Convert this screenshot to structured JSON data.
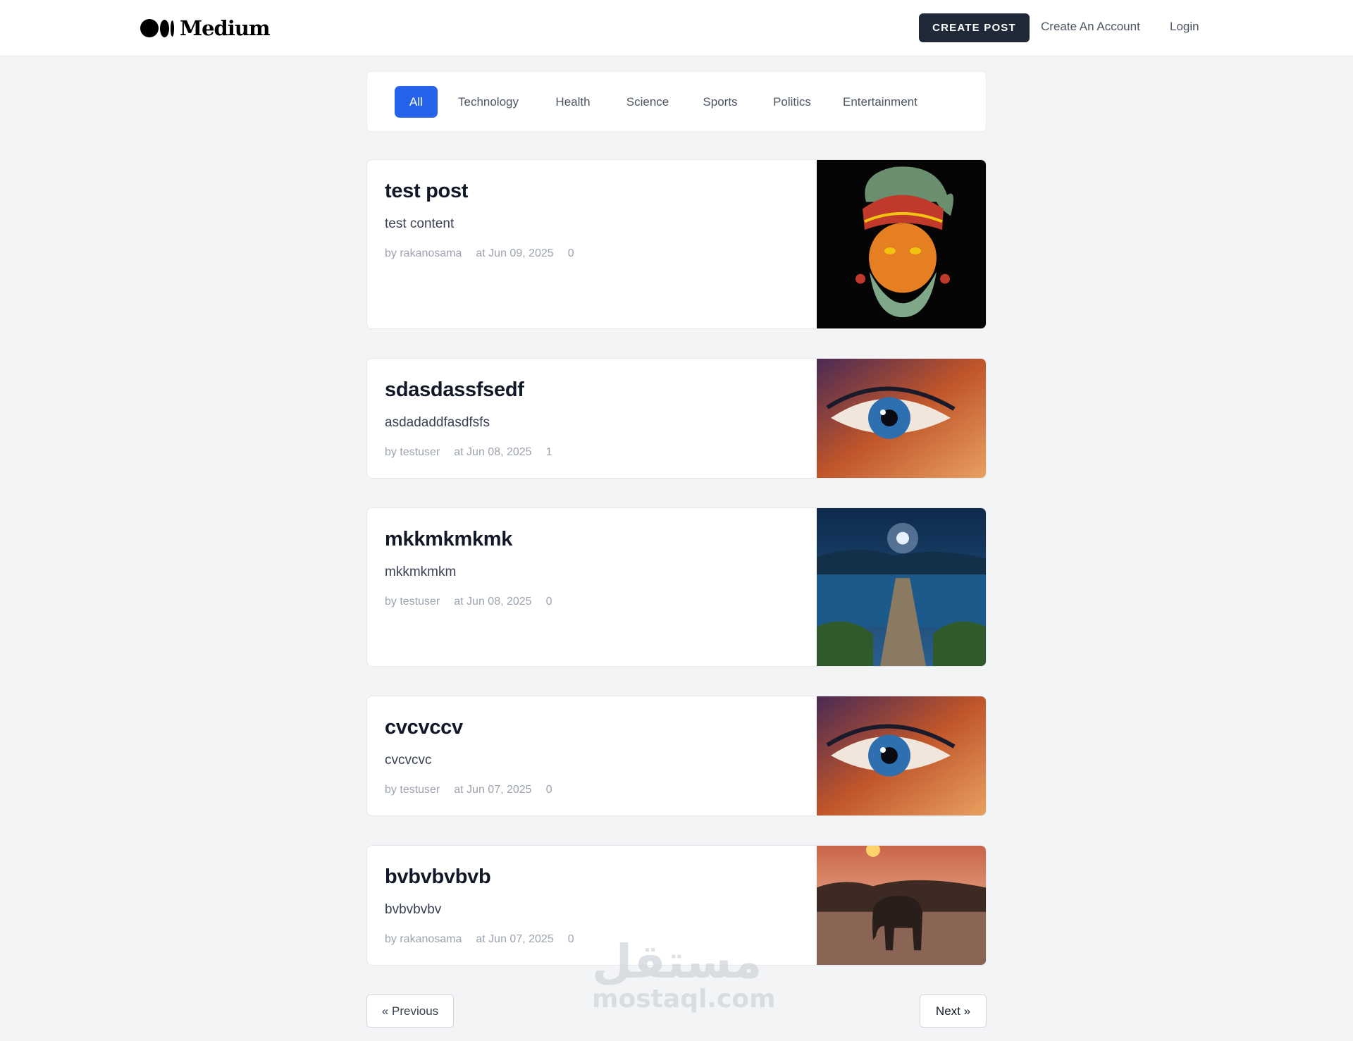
{
  "header": {
    "logo_text": "Medium",
    "create_post_label": "CREATE POST",
    "create_account_label": "Create An Account",
    "login_label": "Login"
  },
  "categories": {
    "active": "All",
    "items": [
      "All",
      "Technology",
      "Health",
      "Science",
      "Sports",
      "Politics",
      "Entertainment"
    ]
  },
  "posts": [
    {
      "title": "test post",
      "excerpt": "test content",
      "author": "by rakanosama",
      "date": "at Jun 09, 2025",
      "count": "0",
      "image": "warrior-portrait-illustration"
    },
    {
      "title": "sdasdassfsedf",
      "excerpt": "asdadaddfasdfsfs",
      "author": "by testuser",
      "date": "at Jun 08, 2025",
      "count": "1",
      "image": "colorful-eye-closeup"
    },
    {
      "title": "mkkmkmkmk",
      "excerpt": "mkkmkmkm",
      "author": "by testuser",
      "date": "at Jun 08, 2025",
      "count": "0",
      "image": "moonlit-lake-pier"
    },
    {
      "title": "cvcvccv",
      "excerpt": "cvcvcvc",
      "author": "by testuser",
      "date": "at Jun 07, 2025",
      "count": "0",
      "image": "colorful-eye-closeup"
    },
    {
      "title": "bvbvbvbvb",
      "excerpt": "bvbvbvbv",
      "author": "by rakanosama",
      "date": "at Jun 07, 2025",
      "count": "0",
      "image": "elephant-sunset"
    }
  ],
  "pagination": {
    "previous_label": "« Previous",
    "next_label": "Next »"
  },
  "watermark": {
    "arabic": "مستقل",
    "latin": "mostaql.com"
  }
}
